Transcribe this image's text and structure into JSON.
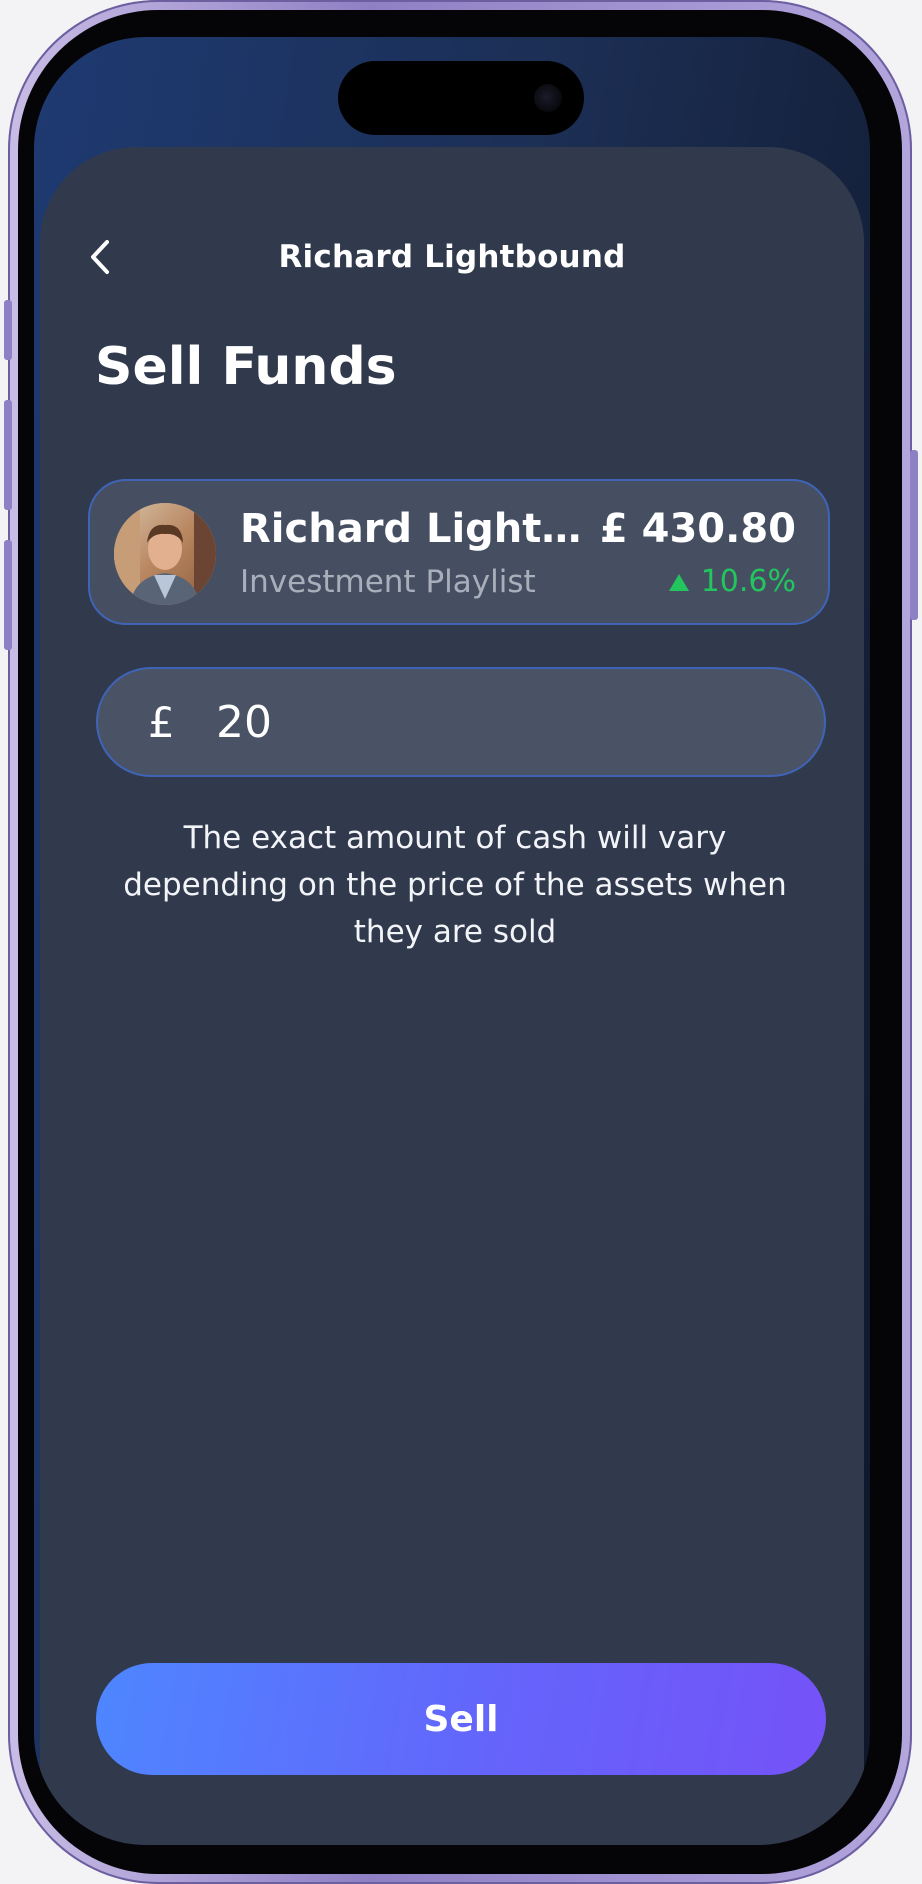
{
  "header": {
    "title": "Richard Lightbound"
  },
  "page": {
    "heading": "Sell Funds"
  },
  "fund": {
    "name": "Richard Lightbound",
    "subtitle": "Investment Playlist",
    "value": "£ 430.80",
    "change": "10.6%",
    "change_color": "#22c55e"
  },
  "amount": {
    "currency": "£",
    "value": "20"
  },
  "note": "The exact amount of cash will vary depending on the price of the assets when they are sold",
  "actions": {
    "sell_label": "Sell"
  },
  "icons": {
    "back": "chevron-left-icon",
    "trend": "triangle-up-icon"
  },
  "colors": {
    "sheet": "#313a4d",
    "button_start": "#4e86ff",
    "button_end": "#7552f8",
    "field_border": "#3f64b7"
  }
}
